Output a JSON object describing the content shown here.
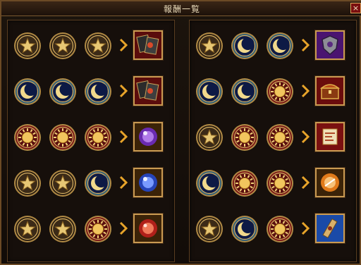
{
  "dialog": {
    "title": "報酬一覧",
    "close_label": "×"
  },
  "colors": {
    "frame_gold": "#c99a52",
    "close_red": "#7a0f0f",
    "panel_bg": "#160f0b"
  },
  "left_rows": [
    {
      "medals": [
        "star",
        "star",
        "star"
      ],
      "reward": "card-red"
    },
    {
      "medals": [
        "moon",
        "moon",
        "moon"
      ],
      "reward": "card-red"
    },
    {
      "medals": [
        "sun",
        "sun",
        "sun"
      ],
      "reward": "purple-orb"
    },
    {
      "medals": [
        "star",
        "star",
        "moon"
      ],
      "reward": "blue-orb"
    },
    {
      "medals": [
        "star",
        "star",
        "sun"
      ],
      "reward": "red-gem"
    }
  ],
  "right_rows": [
    {
      "medals": [
        "star",
        "moon",
        "moon"
      ],
      "reward": "purple-shield"
    },
    {
      "medals": [
        "moon",
        "moon",
        "sun"
      ],
      "reward": "treasure-chest"
    },
    {
      "medals": [
        "star",
        "sun",
        "sun"
      ],
      "reward": "exp-scroll"
    },
    {
      "medals": [
        "moon",
        "sun",
        "sun"
      ],
      "reward": "orange-orb"
    },
    {
      "medals": [
        "star",
        "moon",
        "sun"
      ],
      "reward": "blue-scroll"
    }
  ]
}
